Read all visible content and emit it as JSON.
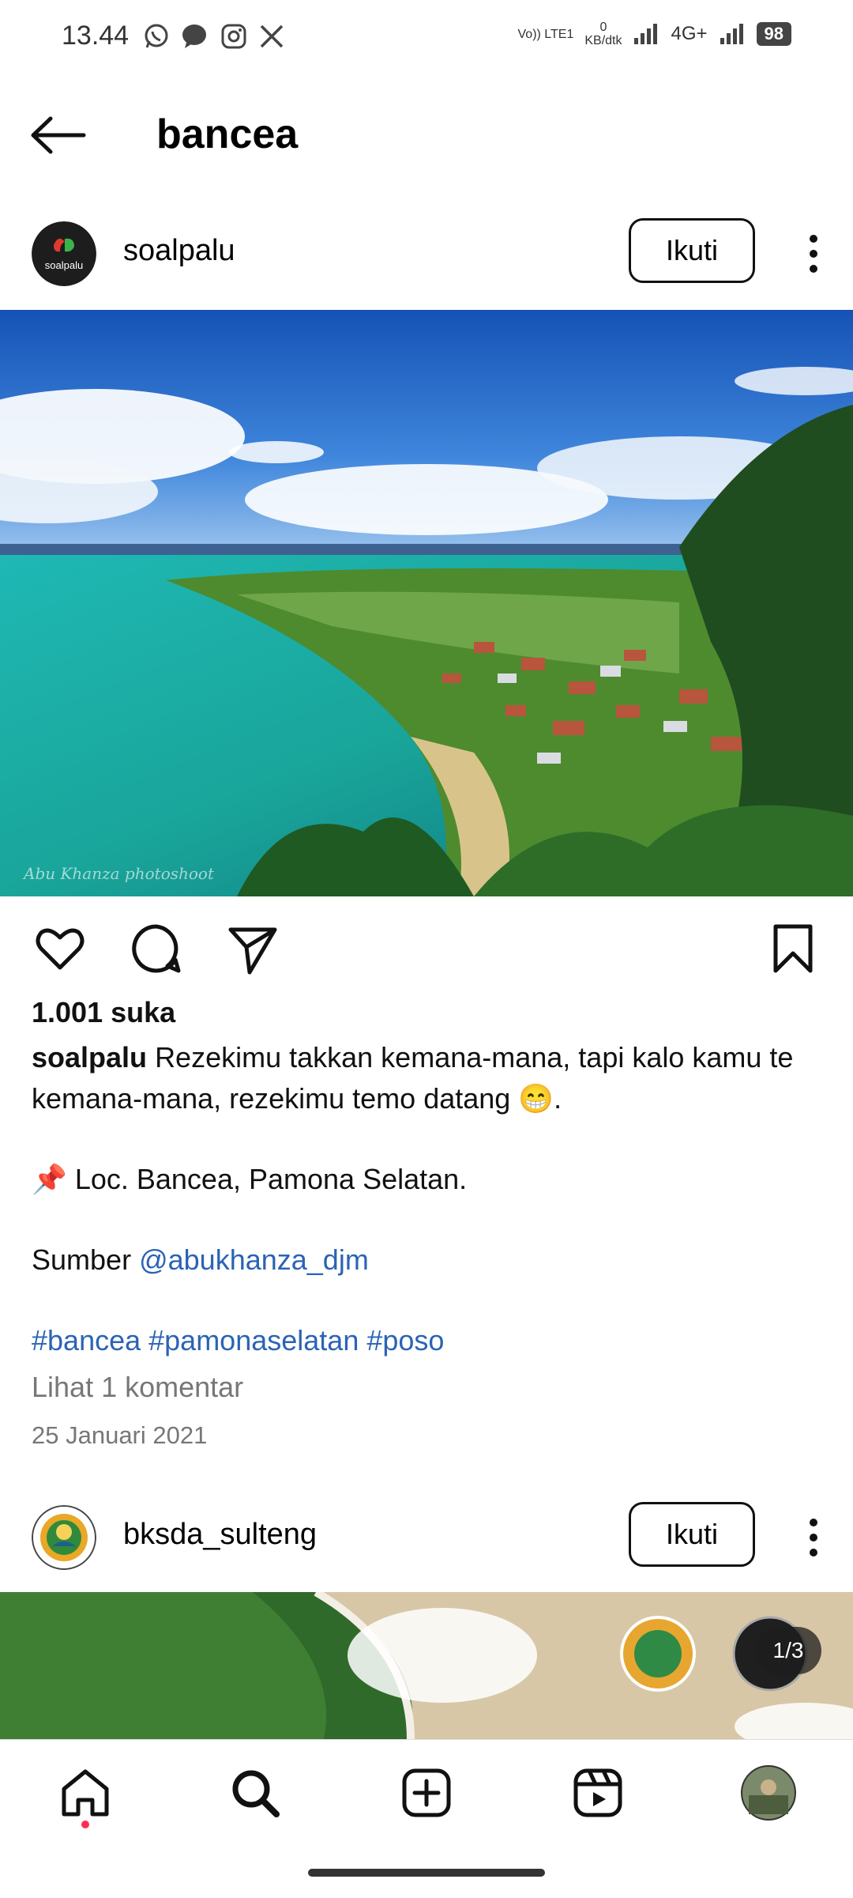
{
  "status_bar": {
    "time": "13.44",
    "volte_label": "Vo)) LTE1",
    "speed_value": "0",
    "speed_unit": "KB/dtk",
    "network_type": "4G+",
    "battery": "98",
    "left_icons": [
      "whatsapp-icon",
      "message-icon",
      "instagram-icon",
      "x-icon"
    ]
  },
  "header": {
    "title": "bancea"
  },
  "post1": {
    "username": "soalpalu",
    "avatar_text": "soalpalu",
    "follow_label": "Ikuti",
    "watermark": "Abu Khanza photoshoot",
    "likes": "1.001 suka",
    "caption_user": "soalpalu",
    "caption_text": "Rezekimu takkan kemana-mana, tapi kalo kamu te kemana-mana, rezekimu temo datang 😁.",
    "location_line": "📌 Loc. Bancea, Pamona Selatan.",
    "source_prefix": "Sumber",
    "source_mention": "@abukhanza_djm",
    "hashtags": "#bancea #pamonaselatan #poso",
    "view_comments": "Lihat 1 komentar",
    "date": "25 Januari 2021"
  },
  "post2": {
    "username": "bksda_sulteng",
    "follow_label": "Ikuti",
    "counter": "1/3"
  },
  "colors": {
    "link": "#2b63b5",
    "home_dot": "#ff2d55"
  }
}
